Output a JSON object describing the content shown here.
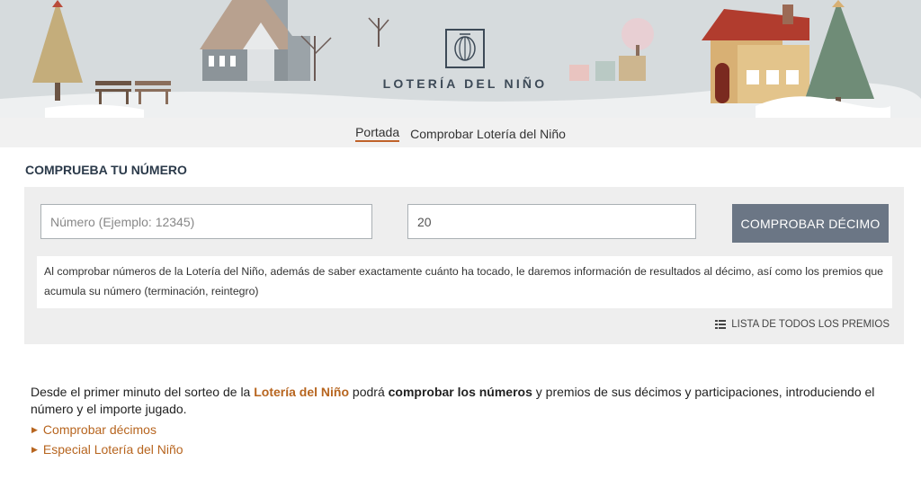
{
  "banner": {
    "logo_text": "LOTERÍA DEL NIÑO"
  },
  "nav": {
    "items": [
      {
        "label": "Portada",
        "active": true
      },
      {
        "label": "Comprobar Lotería del Niño",
        "active": false
      }
    ]
  },
  "check": {
    "title": "COMPRUEBA TU NÚMERO",
    "number_placeholder": "Número (Ejemplo: 12345)",
    "amount_value": "20",
    "button_label": "COMPROBAR DÉCIMO",
    "info_text": "Al comprobar números de la Lotería del Niño, además de saber exactamente cuánto ha tocado, le daremos información de resultados al décimo, así como los premios que acumula su número (terminación, reintegro)",
    "prizes_link": "LISTA DE TODOS LOS PREMIOS"
  },
  "description": {
    "part1": "Desde el primer minuto del sorteo de la ",
    "link1": "Lotería del Niño",
    "part2": " podrá ",
    "bold": "comprobar los números",
    "part3": " y premios de sus décimos y participaciones, introduciendo el número y el importe jugado."
  },
  "links": [
    "Comprobar décimos",
    "Especial Lotería del Niño"
  ]
}
